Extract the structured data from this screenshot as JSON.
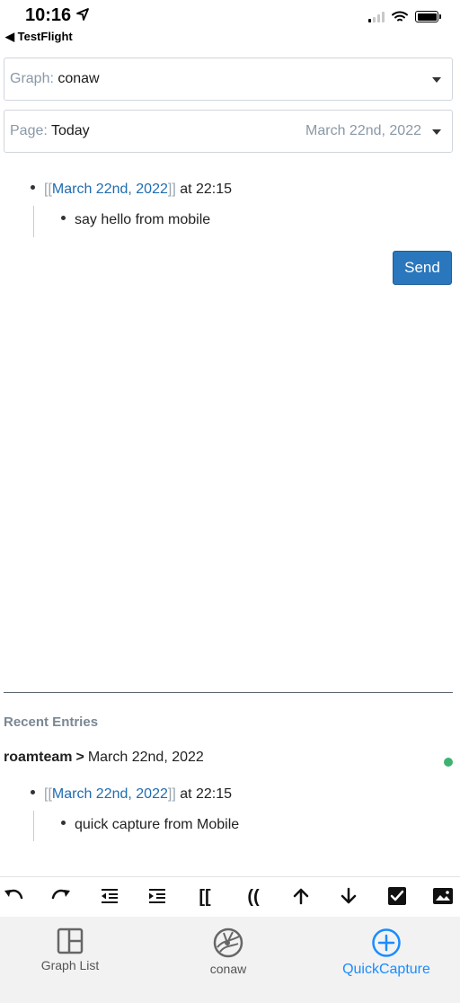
{
  "status_bar": {
    "time": "10:16",
    "location_arrow": "➤",
    "back_label": "◀ TestFlight"
  },
  "selectors": {
    "graph": {
      "label": "Graph: ",
      "value": "conaw"
    },
    "page": {
      "label": "Page: ",
      "value": "Today",
      "date": "March 22nd, 2022"
    }
  },
  "capture": {
    "open_bracket": "[[",
    "link_text": "March 22nd, 2022",
    "close_bracket": "]]",
    "time_text": " at 22:15",
    "child_text": "say hello from mobile",
    "send_label": "Send"
  },
  "recent": {
    "title": "Recent Entries",
    "graph_name": "roamteam",
    "separator": ">",
    "page_name": "March 22nd, 2022",
    "status_color": "#3cb371",
    "entry": {
      "open_bracket": "[[",
      "link_text": "March 22nd, 2022",
      "close_bracket": "]]",
      "time_text": " at 22:15",
      "child_text": "quick capture from Mobile"
    }
  },
  "toolbar": {
    "items": [
      {
        "icon": "undo-icon"
      },
      {
        "icon": "redo-icon"
      },
      {
        "icon": "outdent-icon"
      },
      {
        "icon": "indent-icon"
      },
      {
        "icon": "page-ref-icon",
        "glyph": "[["
      },
      {
        "icon": "block-ref-icon",
        "glyph": "(("
      },
      {
        "icon": "move-up-icon"
      },
      {
        "icon": "move-down-icon"
      },
      {
        "icon": "checkbox-icon"
      },
      {
        "icon": "image-icon"
      }
    ]
  },
  "tabs": [
    {
      "label": "Graph List",
      "icon": "layout-icon"
    },
    {
      "label": "conaw",
      "icon": "graph-avatar-icon"
    },
    {
      "label": "QuickCapture",
      "icon": "plus-circle-icon",
      "active": true
    }
  ],
  "colors": {
    "accent": "#1a8cff",
    "link": "#1f6db0",
    "send_button": "#2a77bd"
  }
}
